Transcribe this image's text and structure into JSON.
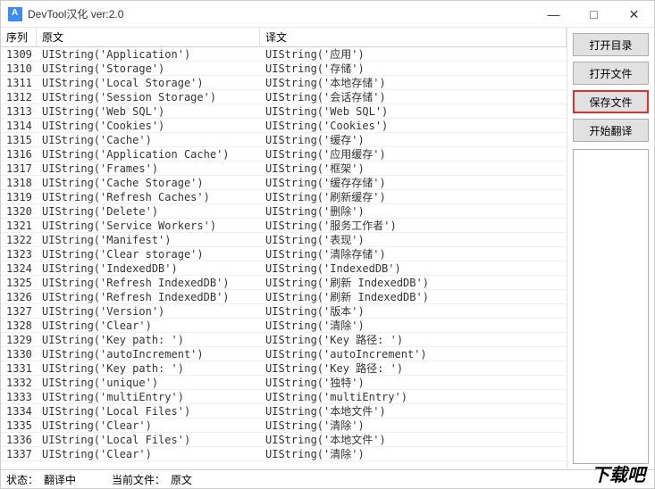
{
  "window": {
    "title": "DevTool汉化 ver:2.0"
  },
  "headers": {
    "seq": "序列",
    "orig": "原文",
    "trans": "译文"
  },
  "rows": [
    {
      "seq": "1309",
      "orig": "UIString('Application')",
      "trans": "UIString('应用')"
    },
    {
      "seq": "1310",
      "orig": "UIString('Storage')",
      "trans": "UIString('存储')"
    },
    {
      "seq": "1311",
      "orig": "UIString('Local Storage')",
      "trans": "UIString('本地存储')"
    },
    {
      "seq": "1312",
      "orig": "UIString('Session Storage')",
      "trans": "UIString('会话存储')"
    },
    {
      "seq": "1313",
      "orig": "UIString('Web SQL')",
      "trans": "UIString('Web SQL')"
    },
    {
      "seq": "1314",
      "orig": "UIString('Cookies')",
      "trans": "UIString('Cookies')"
    },
    {
      "seq": "1315",
      "orig": "UIString('Cache')",
      "trans": "UIString('缓存')"
    },
    {
      "seq": "1316",
      "orig": "UIString('Application Cache')",
      "trans": "UIString('应用缓存')"
    },
    {
      "seq": "1317",
      "orig": "UIString('Frames')",
      "trans": "UIString('框架')"
    },
    {
      "seq": "1318",
      "orig": "UIString('Cache Storage')",
      "trans": "UIString('缓存存储')"
    },
    {
      "seq": "1319",
      "orig": "UIString('Refresh Caches')",
      "trans": "UIString('刷新缓存')"
    },
    {
      "seq": "1320",
      "orig": "UIString('Delete')",
      "trans": "UIString('删除')"
    },
    {
      "seq": "1321",
      "orig": "UIString('Service Workers')",
      "trans": "UIString('服务工作者')"
    },
    {
      "seq": "1322",
      "orig": "UIString('Manifest')",
      "trans": "UIString('表现')"
    },
    {
      "seq": "1323",
      "orig": "UIString('Clear storage')",
      "trans": "UIString('清除存储')"
    },
    {
      "seq": "1324",
      "orig": "UIString('IndexedDB')",
      "trans": "UIString('IndexedDB')"
    },
    {
      "seq": "1325",
      "orig": "UIString('Refresh IndexedDB')",
      "trans": "UIString('刷新 IndexedDB')"
    },
    {
      "seq": "1326",
      "orig": "UIString('Refresh IndexedDB')",
      "trans": "UIString('刷新 IndexedDB')"
    },
    {
      "seq": "1327",
      "orig": "UIString('Version')",
      "trans": "UIString('版本')"
    },
    {
      "seq": "1328",
      "orig": "UIString('Clear')",
      "trans": "UIString('清除')"
    },
    {
      "seq": "1329",
      "orig": "UIString('Key path: ')",
      "trans": "UIString('Key 路径: ')"
    },
    {
      "seq": "1330",
      "orig": "UIString('autoIncrement')",
      "trans": "UIString('autoIncrement')"
    },
    {
      "seq": "1331",
      "orig": "UIString('Key path: ')",
      "trans": "UIString('Key 路径: ')"
    },
    {
      "seq": "1332",
      "orig": "UIString('unique')",
      "trans": "UIString('独特')"
    },
    {
      "seq": "1333",
      "orig": "UIString('multiEntry')",
      "trans": "UIString('multiEntry')"
    },
    {
      "seq": "1334",
      "orig": "UIString('Local Files')",
      "trans": "UIString('本地文件')"
    },
    {
      "seq": "1335",
      "orig": "UIString('Clear')",
      "trans": "UIString('清除')"
    },
    {
      "seq": "1336",
      "orig": "UIString('Local Files')",
      "trans": "UIString('本地文件')"
    },
    {
      "seq": "1337",
      "orig": "UIString('Clear')",
      "trans": "UIString('清除')"
    }
  ],
  "sidebar": {
    "open_dir": "打开目录",
    "open_file": "打开文件",
    "save_file": "保存文件",
    "start_translate": "开始翻译"
  },
  "status": {
    "state_label": "状态：",
    "mode": "翻译中",
    "current_file_label": "当前文件：",
    "current_file": "原文"
  },
  "watermark": "下载吧",
  "win_controls": {
    "min": "—",
    "max": "□",
    "close": "✕"
  }
}
